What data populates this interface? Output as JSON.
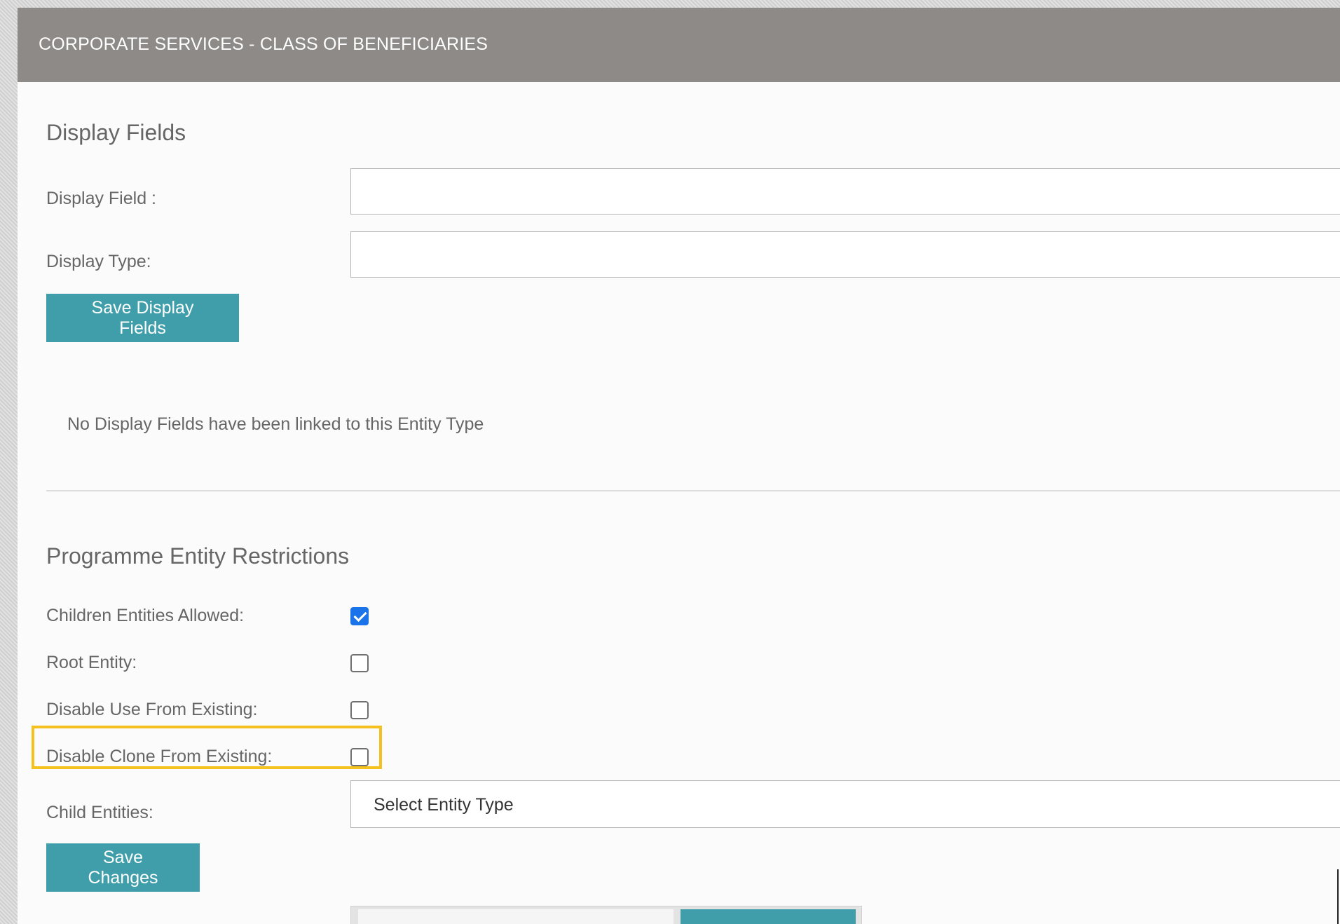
{
  "header": {
    "title": "CORPORATE SERVICES - CLASS OF BENEFICIARIES"
  },
  "display_fields": {
    "title": "Display Fields",
    "display_field_label": "Display Field :",
    "display_field_value": "",
    "display_type_label": "Display Type:",
    "display_type_value": "",
    "save_button_label": "Save Display Fields",
    "empty_message": "No Display Fields have been linked to this Entity Type"
  },
  "restrictions": {
    "title": "Programme Entity Restrictions",
    "children_allowed_label": "Children Entities Allowed:",
    "children_allowed_checked": true,
    "root_entity_label": "Root Entity:",
    "root_entity_checked": false,
    "disable_use_label": "Disable Use From Existing:",
    "disable_use_checked": false,
    "disable_clone_label": "Disable Clone From Existing:",
    "disable_clone_checked": false,
    "child_entities_label": "Child Entities:",
    "child_entities_placeholder": "Select Entity Type",
    "save_button_label": "Save Changes"
  },
  "colors": {
    "header_bg": "#8d8a88",
    "button_bg": "#3f9eaa",
    "highlight": "#f5c11e",
    "checkbox_checked": "#1a73e8"
  }
}
